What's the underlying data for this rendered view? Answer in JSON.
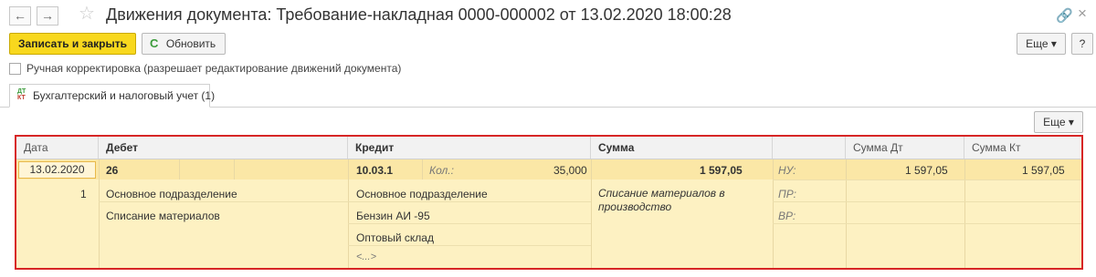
{
  "window": {
    "title": "Движения документа: Требование-накладная 0000-000002 от 13.02.2020 18:00:28",
    "back_glyph": "←",
    "forward_glyph": "→",
    "favorite_glyph": "☆",
    "link_glyph": "🔗",
    "close_glyph": "×"
  },
  "toolbar": {
    "save_close_label": "Записать и закрыть",
    "refresh_label": "Обновить",
    "refresh_glyph": "C",
    "more_label": "Еще ▾",
    "help_label": "?"
  },
  "manual_correction": {
    "label": "Ручная корректировка (разрешает редактирование движений документа)",
    "checked": false
  },
  "tabs": [
    {
      "label": "Бухгалтерский и налоговый учет (1)",
      "icon": "dt-kt-icon",
      "icon_dt": "ДТ",
      "icon_kt": "КТ",
      "active": true
    }
  ],
  "grid_toolbar": {
    "more_label": "Еще ▾"
  },
  "grid": {
    "columns": [
      "Дата",
      "Дебет",
      "Кредит",
      "Сумма",
      "",
      "Сумма Дт",
      "Сумма Кт"
    ],
    "record": {
      "date": "13.02.2020",
      "number": "1",
      "debit_account": "26",
      "debit_subconto": [
        "Основное подразделение",
        "Списание материалов"
      ],
      "credit_account": "10.03.1",
      "qty_label": "Кол.:",
      "qty_value": "35,000",
      "credit_subconto": [
        "Основное подразделение",
        "Бензин АИ -95",
        "Оптовый склад",
        "<...>"
      ],
      "amount": "1 597,05",
      "description": "Списание материалов в производство",
      "tax_labels": [
        "НУ:",
        "ПР:",
        "ВР:"
      ],
      "amount_dt": "1 597,05",
      "amount_kt": "1 597,05"
    }
  },
  "colors": {
    "primary_button": "#f8d81e",
    "grid_background": "#fdf1c2",
    "selected_row": "#fbe7a6",
    "highlight_border": "#d72626"
  }
}
